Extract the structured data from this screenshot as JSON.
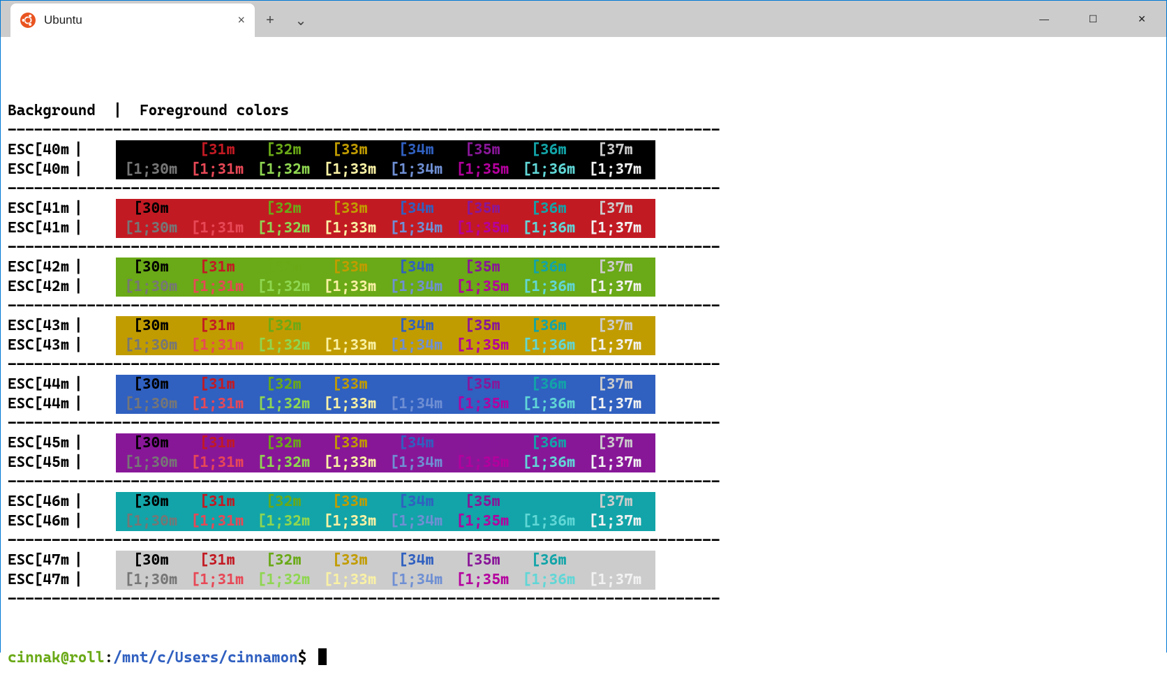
{
  "titlebar": {
    "tab_title": "Ubuntu",
    "close_glyph": "×",
    "new_tab_glyph": "+",
    "dropdown_glyph": "⌄",
    "minimize_glyph": "—",
    "maximize_glyph": "☐",
    "close_win_glyph": "✕"
  },
  "header": {
    "bg_label": "Background",
    "sep": "|",
    "fg_label": "Foreground colors"
  },
  "divider_len": 81,
  "palette": {
    "normal": [
      "#000000",
      "#c21a23",
      "#6aa917",
      "#c19c00",
      "#3060c0",
      "#881798",
      "#12a4a8",
      "#cccccc"
    ],
    "bright": [
      "#767676",
      "#e74856",
      "#8fd651",
      "#f9f1a5",
      "#6f8fd3",
      "#b4009e",
      "#61d6d6",
      "#f2f2f2"
    ]
  },
  "bg_codes": [
    "40",
    "41",
    "42",
    "43",
    "44",
    "45",
    "46",
    "47"
  ],
  "fg_codes": [
    "30",
    "31",
    "32",
    "33",
    "34",
    "35",
    "36",
    "37"
  ],
  "prompt": {
    "user": "cinnak@roll",
    "colon": ":",
    "path": "/mnt/c/Users/cinnamon",
    "dollar": "$"
  }
}
